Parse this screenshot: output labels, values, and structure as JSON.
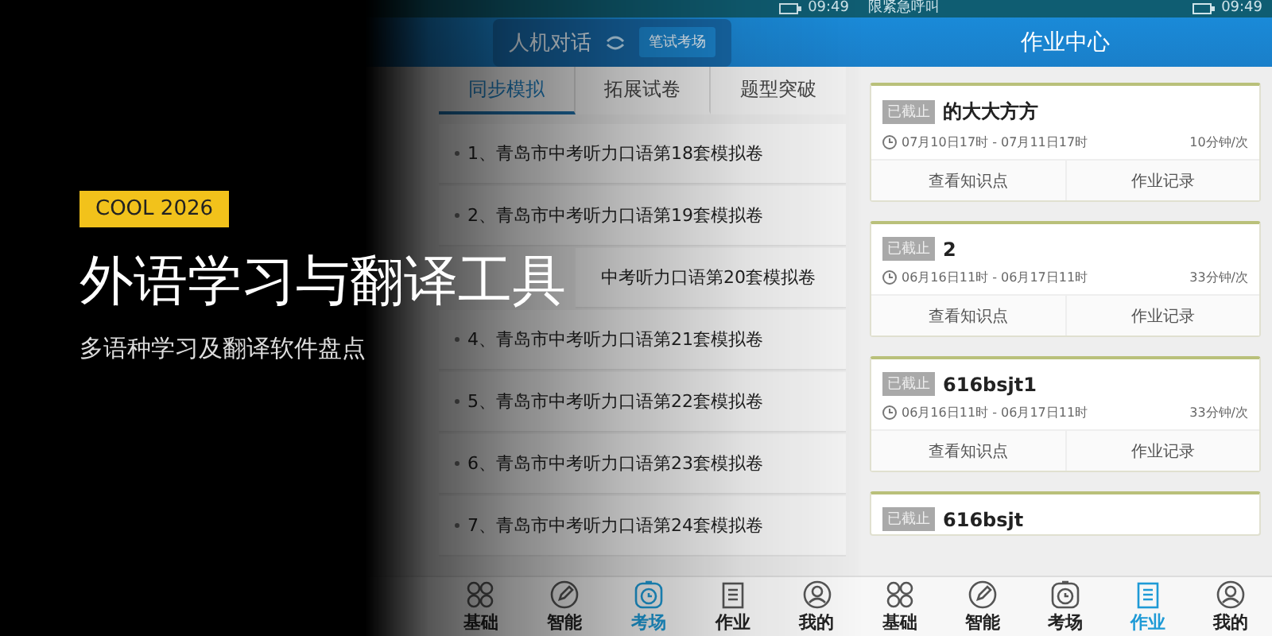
{
  "banner": {
    "tag": "COOL 2026",
    "title": "外语学习与翻译工具",
    "subtitle": "多语种学习及翻译软件盘点"
  },
  "exam_screen": {
    "status_bar": {
      "time": "09:49"
    },
    "modes": [
      {
        "label": "人机对话",
        "selected": false
      },
      {
        "label": "笔试考场",
        "selected": true
      }
    ],
    "tabs": [
      {
        "label": "同步模拟",
        "selected": true
      },
      {
        "label": "拓展试卷",
        "selected": false
      },
      {
        "label": "题型突破",
        "selected": false
      }
    ],
    "papers": [
      {
        "kind": "full",
        "title": "1、青岛市中考听力口语第18套模拟卷"
      },
      {
        "kind": "full",
        "title": "2、青岛市中考听力口语第19套模拟卷"
      },
      {
        "kind": "covered",
        "title": "中考听力口语第20套模拟卷"
      },
      {
        "kind": "full",
        "title": "4、青岛市中考听力口语第21套模拟卷"
      },
      {
        "kind": "full",
        "title": "5、青岛市中考听力口语第22套模拟卷"
      },
      {
        "kind": "full",
        "title": "6、青岛市中考听力口语第23套模拟卷"
      },
      {
        "kind": "full",
        "title": "7、青岛市中考听力口语第24套模拟卷"
      }
    ],
    "nav": [
      {
        "label": "基础",
        "selected": false
      },
      {
        "label": "智能",
        "selected": false
      },
      {
        "label": "考场",
        "selected": true
      },
      {
        "label": "作业",
        "selected": false
      },
      {
        "label": "我的",
        "selected": false
      }
    ]
  },
  "homework_screen": {
    "status_bar": {
      "carrier": "限紧急呼叫",
      "time": "09:49"
    },
    "title": "作业中心",
    "cards": [
      {
        "status": "已截止",
        "title": "的大大方方",
        "time_range": "07月10日17时 - 07月11日17时",
        "frequency": "10分钟/次",
        "actions": [
          "查看知识点",
          "作业记录"
        ]
      },
      {
        "status": "已截止",
        "title": "2",
        "time_range": "06月16日11时 - 06月17日11时",
        "frequency": "33分钟/次",
        "actions": [
          "查看知识点",
          "作业记录"
        ]
      },
      {
        "status": "已截止",
        "title": "616bsjt1",
        "time_range": "06月16日11时 - 06月17日11时",
        "frequency": "33分钟/次",
        "actions": [
          "查看知识点",
          "作业记录"
        ]
      },
      {
        "status": "已截止",
        "title": "616bsjt"
      }
    ],
    "nav": [
      {
        "label": "基础",
        "selected": false
      },
      {
        "label": "智能",
        "selected": false
      },
      {
        "label": "考场",
        "selected": false
      },
      {
        "label": "作业",
        "selected": true
      },
      {
        "label": "我的",
        "selected": false
      }
    ]
  }
}
